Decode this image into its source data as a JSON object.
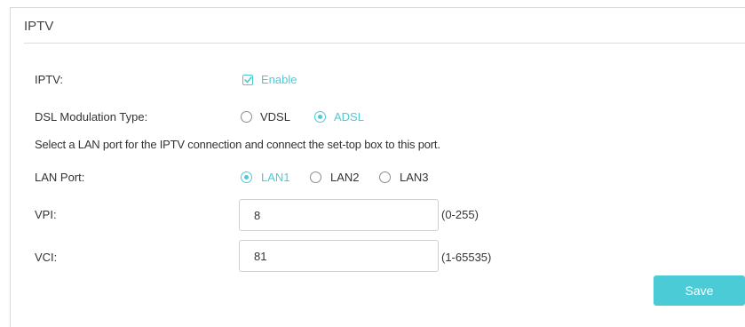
{
  "section": {
    "title": "IPTV"
  },
  "iptv": {
    "label": "IPTV:",
    "enable_label": "Enable",
    "enabled": true
  },
  "dsl": {
    "label": "DSL Modulation Type:",
    "options": [
      {
        "label": "VDSL",
        "selected": false
      },
      {
        "label": "ADSL",
        "selected": true
      }
    ]
  },
  "note": "Select a LAN port for the IPTV connection and connect the set-top box to this port.",
  "lan_port": {
    "label": "LAN Port:",
    "options": [
      {
        "label": "LAN1",
        "selected": true
      },
      {
        "label": "LAN2",
        "selected": false
      },
      {
        "label": "LAN3",
        "selected": false
      }
    ]
  },
  "vpi": {
    "label": "VPI:",
    "value": "8",
    "range": "(0-255)"
  },
  "vci": {
    "label": "VCI:",
    "value": "81",
    "range": "(1-65535)"
  },
  "actions": {
    "save_label": "Save"
  },
  "colors": {
    "accent": "#4acbd6",
    "text": "#333333",
    "border": "#d0d0d0"
  }
}
